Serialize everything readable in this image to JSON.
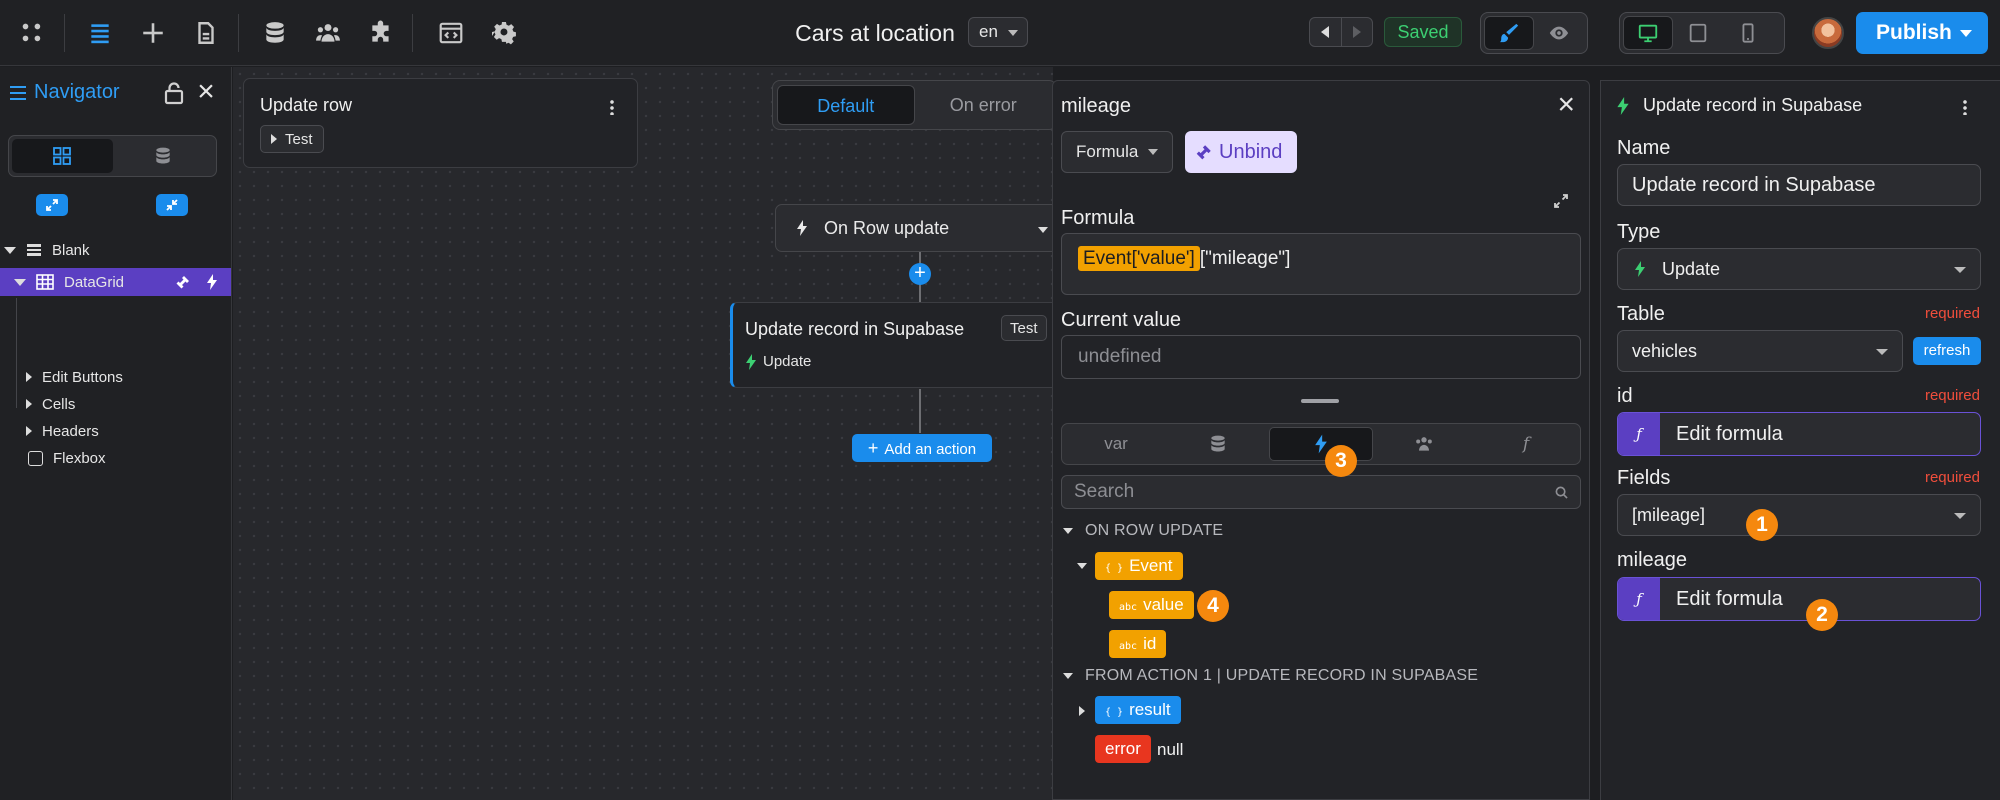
{
  "app": {
    "page_title": "Cars at location",
    "language": "en",
    "save_status": "Saved",
    "publish_label": "Publish",
    "colors": {
      "accent": "#1a8cec",
      "selection": "#5b3fc2",
      "badge": "#f5880e",
      "variable": "#f2a100",
      "error": "#e8361f",
      "required": "#f04e3c"
    }
  },
  "toolbar": {
    "icons": [
      "apps-icon",
      "layers-icon",
      "add-icon",
      "pages-icon",
      "data-icon",
      "users-icon",
      "plugins-icon",
      "code-icon",
      "settings-icon"
    ]
  },
  "navigator": {
    "title": "Navigator",
    "tree": [
      {
        "label": "Blank"
      },
      {
        "label": "DataGrid",
        "selected": true
      },
      {
        "label": "Edit Buttons"
      },
      {
        "label": "Cells"
      },
      {
        "label": "Headers"
      },
      {
        "label": "Flexbox"
      }
    ]
  },
  "canvas": {
    "workflow_card_title": "Update row",
    "test_label": "Test",
    "tabs": [
      {
        "label": "Default",
        "active": true
      },
      {
        "label": "On error",
        "active": false
      }
    ],
    "trigger_label": "On Row update",
    "action": {
      "title": "Update record in Supabase",
      "type": "Update",
      "test_label": "Test"
    },
    "add_action_label": "Add an action"
  },
  "formula_panel": {
    "title": "mileage",
    "mode": "Formula",
    "unbind_label": "Unbind",
    "formula_label": "Formula",
    "formula_token": "Event['value']",
    "formula_suffix": "[\"mileage\"]",
    "current_value_label": "Current value",
    "current_value": "undefined",
    "source_tabs": [
      {
        "label": "var"
      },
      {
        "label": "data-icon"
      },
      {
        "label": "workflow-icon",
        "active": true
      },
      {
        "label": "users-icon"
      },
      {
        "label": "f"
      }
    ],
    "search_placeholder": "Search",
    "sections": [
      {
        "title": "ON ROW UPDATE",
        "object": "Event",
        "fields": [
          "value",
          "id"
        ]
      },
      {
        "title": "FROM ACTION 1 | UPDATE RECORD IN SUPABASE",
        "object": "result",
        "error_label": "error",
        "error_value": "null"
      }
    ]
  },
  "right_panel": {
    "title": "Update record in Supabase",
    "name_label": "Name",
    "name_value": "Update record in Supabase",
    "type_label": "Type",
    "type_value": "Update",
    "table_label": "Table",
    "table_value": "vehicles",
    "refresh_label": "refresh",
    "required_label": "required",
    "id_label": "id",
    "edit_formula_label": "Edit formula",
    "fields_label": "Fields",
    "fields_value": "[mileage]",
    "mileage_label": "mileage"
  },
  "badges": [
    "1",
    "2",
    "3",
    "4"
  ]
}
